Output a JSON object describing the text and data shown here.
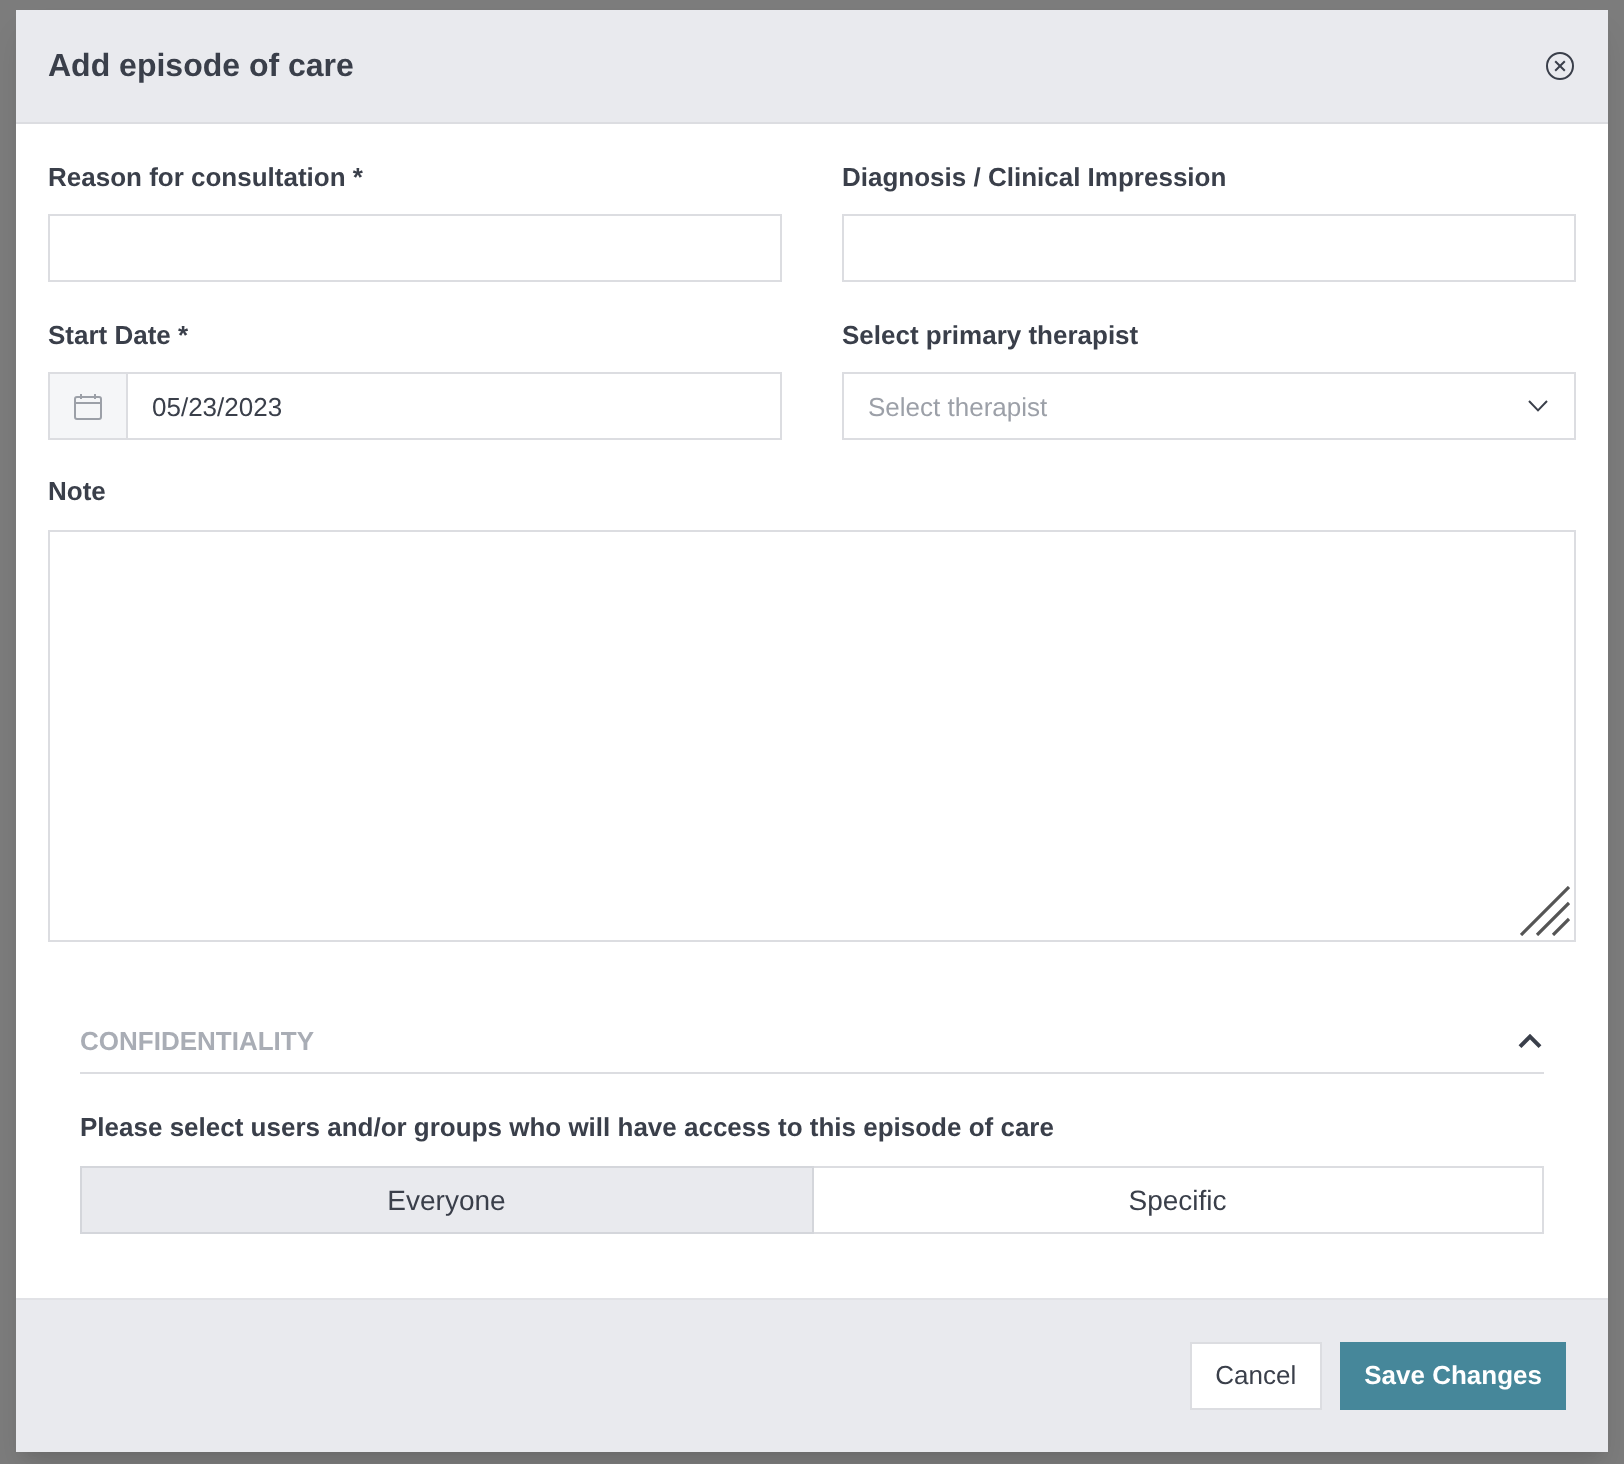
{
  "dialog": {
    "title": "Add episode of care"
  },
  "fields": [
    {
      "kind": "text",
      "label": "Reason for consultation *"
    },
    {
      "kind": "text",
      "label": "Diagnosis / Clinical Impression"
    },
    {
      "kind": "date",
      "label": "Start Date *",
      "value": "05/23/2023"
    },
    {
      "kind": "select",
      "label": "Select primary therapist",
      "placeholder": "Select therapist"
    }
  ],
  "note": {
    "label": "Note"
  },
  "confidentiality": {
    "title": "CONFIDENTIALITY",
    "expanded": true,
    "prompt": "Please select users and/or groups who will have access to this episode of care",
    "options": [
      {
        "label": "Everyone",
        "selected": true
      },
      {
        "label": "Specific",
        "selected": false
      }
    ]
  },
  "buttons": [
    {
      "kind": "secondary",
      "label": "Cancel"
    },
    {
      "kind": "primary",
      "label": "Save Changes"
    }
  ]
}
